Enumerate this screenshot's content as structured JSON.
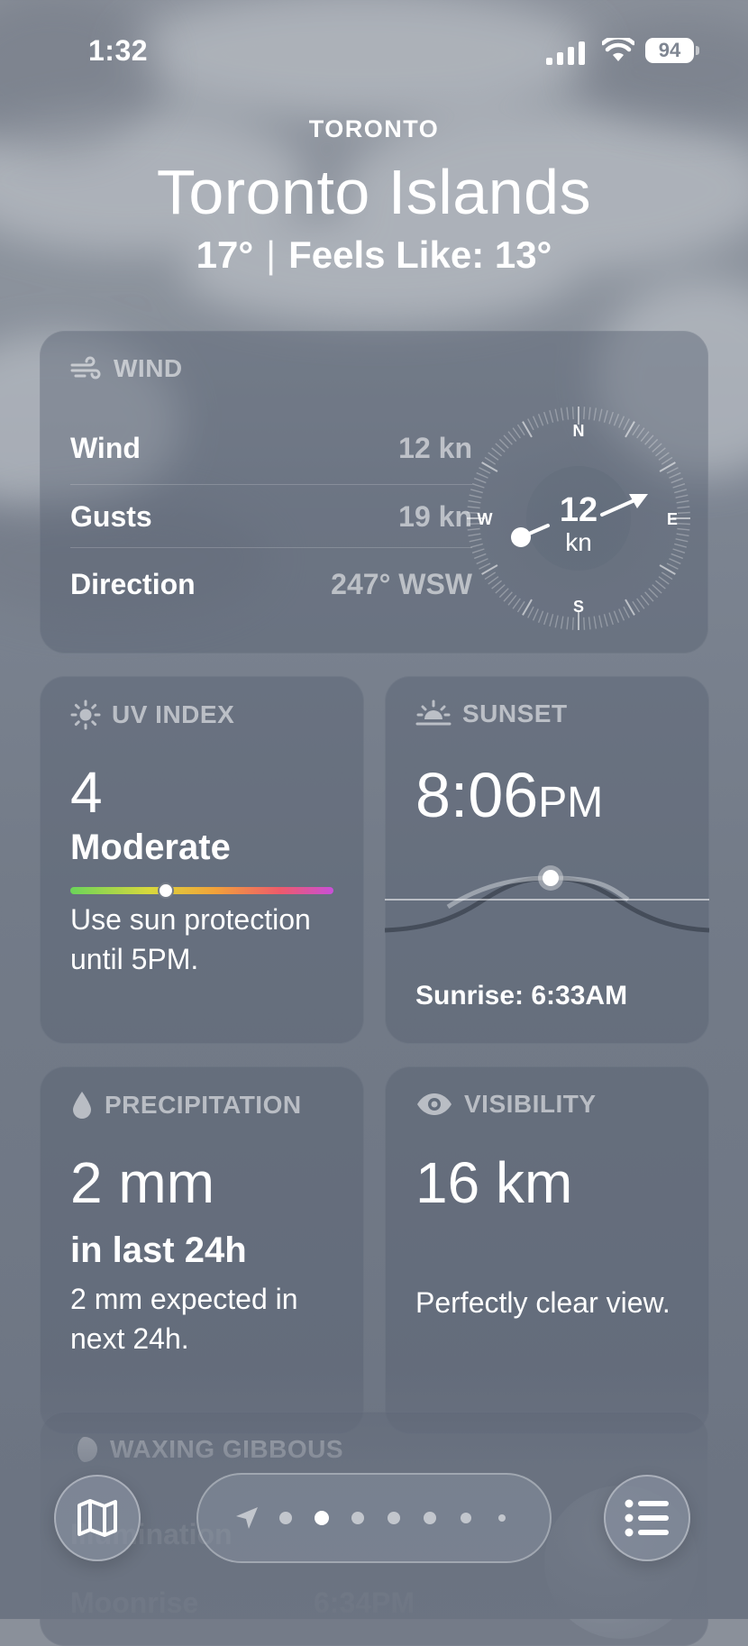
{
  "status_bar": {
    "time": "1:32",
    "battery": "94"
  },
  "location": {
    "region": "TORONTO",
    "name": "Toronto Islands",
    "temp": "17°",
    "feels_like": "Feels Like: 13°"
  },
  "wind": {
    "title": "WIND",
    "rows": [
      {
        "label": "Wind",
        "value": "12 kn"
      },
      {
        "label": "Gusts",
        "value": "19 kn"
      },
      {
        "label": "Direction",
        "value": "247° WSW"
      }
    ],
    "compass": {
      "speed": "12",
      "unit": "kn",
      "n": "N",
      "e": "E",
      "s": "S",
      "w": "W",
      "direction_deg": 247
    }
  },
  "uv": {
    "title": "UV INDEX",
    "value": "4",
    "level": "Moderate",
    "fraction": 0.36,
    "desc": "Use sun protection until 5PM."
  },
  "sunset": {
    "title": "SUNSET",
    "time": "8:06",
    "ampm": "PM",
    "sunrise": "Sunrise: 6:33AM"
  },
  "precipitation": {
    "title": "PRECIPITATION",
    "value": "2 mm",
    "period": "in last 24h",
    "desc": "2 mm expected in next 24h."
  },
  "visibility": {
    "title": "VISIBILITY",
    "value": "16 km",
    "desc": "Perfectly clear view."
  },
  "moon": {
    "title": "WAXING GIBBOUS",
    "rows": [
      {
        "label": "Illumination",
        "value": ""
      },
      {
        "label": "Moonrise",
        "value": "6:34PM"
      }
    ]
  },
  "nav": {
    "pages": 7,
    "active_index": 1
  }
}
